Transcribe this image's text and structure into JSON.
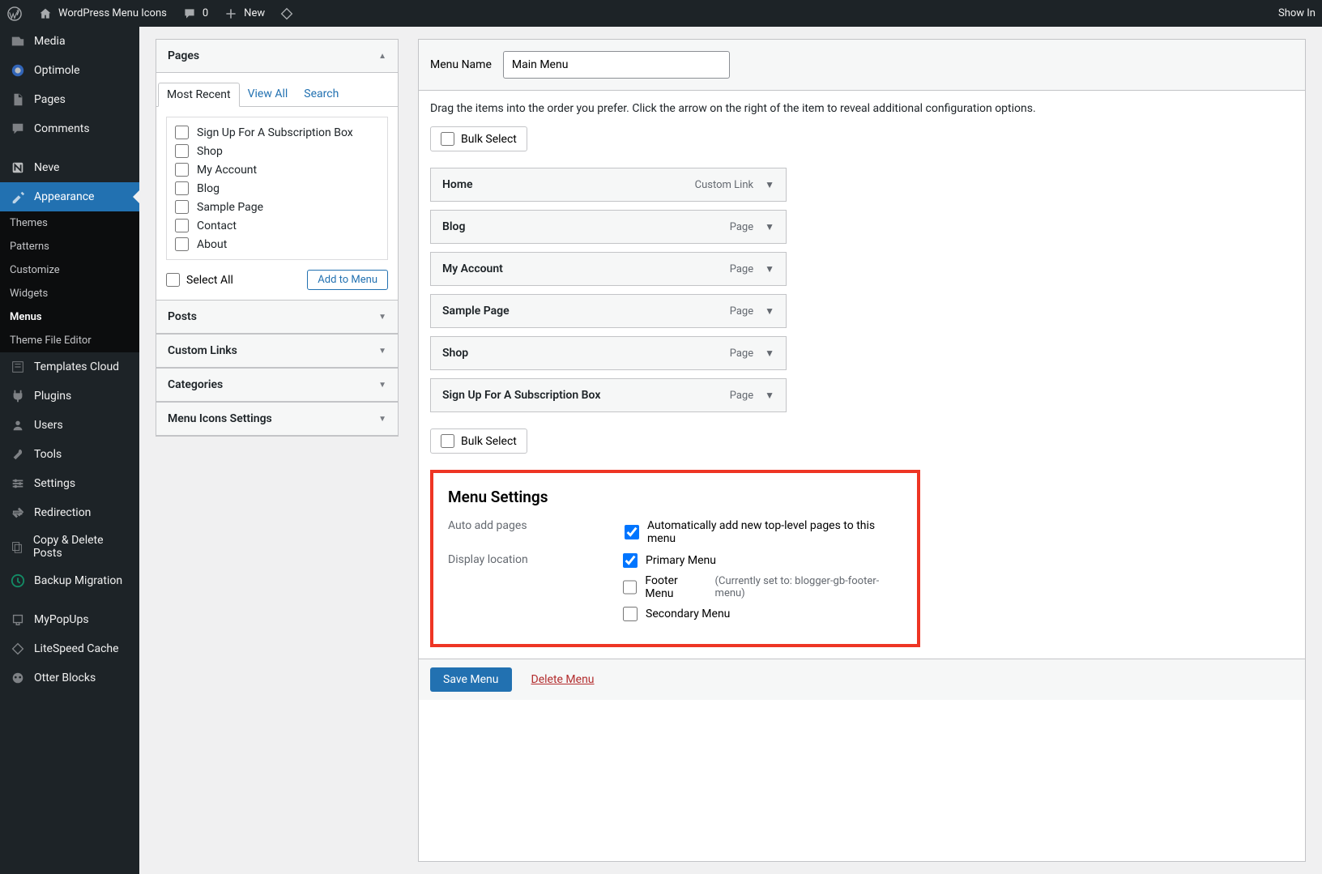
{
  "topbar": {
    "site_title": "WordPress Menu Icons",
    "comments_count": "0",
    "new_label": "New",
    "show_in": "Show In"
  },
  "sidebar": {
    "items": [
      {
        "label": "Media"
      },
      {
        "label": "Optimole"
      },
      {
        "label": "Pages"
      },
      {
        "label": "Comments"
      },
      {
        "label": "Neve"
      },
      {
        "label": "Appearance"
      },
      {
        "label": "Templates Cloud"
      },
      {
        "label": "Plugins"
      },
      {
        "label": "Users"
      },
      {
        "label": "Tools"
      },
      {
        "label": "Settings"
      },
      {
        "label": "Redirection"
      },
      {
        "label": "Copy & Delete Posts"
      },
      {
        "label": "Backup Migration"
      },
      {
        "label": "MyPopUps"
      },
      {
        "label": "LiteSpeed Cache"
      },
      {
        "label": "Otter Blocks"
      }
    ],
    "subitems": [
      {
        "label": "Themes"
      },
      {
        "label": "Patterns"
      },
      {
        "label": "Customize"
      },
      {
        "label": "Widgets"
      },
      {
        "label": "Menus"
      },
      {
        "label": "Theme File Editor"
      }
    ]
  },
  "metabox": {
    "pages": {
      "title": "Pages",
      "tabs": [
        "Most Recent",
        "View All",
        "Search"
      ],
      "items": [
        "Sign Up For A Subscription Box",
        "Shop",
        "My Account",
        "Blog",
        "Sample Page",
        "Contact",
        "About"
      ],
      "select_all": "Select All",
      "add_button": "Add to Menu"
    },
    "collapsed": [
      "Posts",
      "Custom Links",
      "Categories",
      "Menu Icons Settings"
    ]
  },
  "content": {
    "menu_name_label": "Menu Name",
    "menu_name_value": "Main Menu",
    "instructions": "Drag the items into the order you prefer. Click the arrow on the right of the item to reveal additional configuration options.",
    "bulk_select": "Bulk Select",
    "items": [
      {
        "title": "Home",
        "type": "Custom Link"
      },
      {
        "title": "Blog",
        "type": "Page"
      },
      {
        "title": "My Account",
        "type": "Page"
      },
      {
        "title": "Sample Page",
        "type": "Page"
      },
      {
        "title": "Shop",
        "type": "Page"
      },
      {
        "title": "Sign Up For A Subscription Box",
        "type": "Page"
      }
    ],
    "settings_title": "Menu Settings",
    "auto_add_label": "Auto add pages",
    "auto_add_checkbox": "Automatically add new top-level pages to this menu",
    "display_location_label": "Display location",
    "locations": [
      {
        "label": "Primary Menu",
        "checked": true,
        "hint": ""
      },
      {
        "label": "Footer Menu",
        "checked": false,
        "hint": "(Currently set to: blogger-gb-footer-menu)"
      },
      {
        "label": "Secondary Menu",
        "checked": false,
        "hint": ""
      }
    ],
    "save_button": "Save Menu",
    "delete_link": "Delete Menu"
  }
}
